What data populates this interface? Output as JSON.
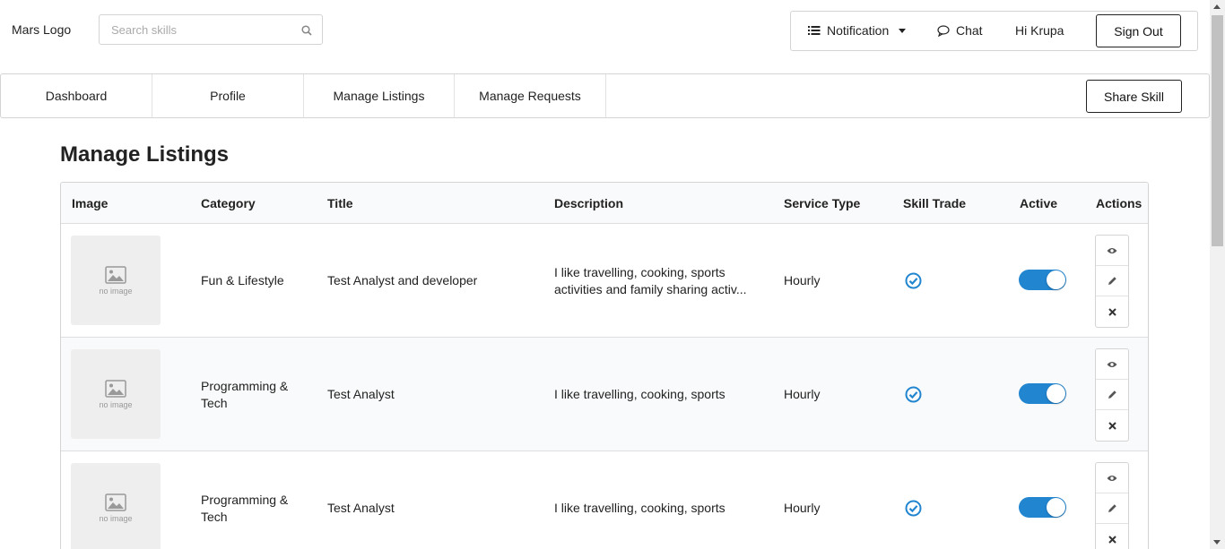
{
  "header": {
    "logo": "Mars Logo",
    "search_placeholder": "Search skills",
    "notification_label": "Notification",
    "chat_label": "Chat",
    "greeting": "Hi Krupa",
    "signout_label": "Sign Out"
  },
  "nav": {
    "tabs": [
      {
        "label": "Dashboard"
      },
      {
        "label": "Profile"
      },
      {
        "label": "Manage Listings"
      },
      {
        "label": "Manage Requests"
      }
    ],
    "share_label": "Share Skill"
  },
  "page_title": "Manage Listings",
  "table": {
    "columns": [
      "Image",
      "Category",
      "Title",
      "Description",
      "Service Type",
      "Skill Trade",
      "Active",
      "Actions"
    ],
    "no_image_text": "no image",
    "rows": [
      {
        "category": "Fun & Lifestyle",
        "title": "Test Analyst and developer",
        "description": "I like travelling, cooking, sports activities and family sharing activ...",
        "service_type": "Hourly",
        "skill_trade": true,
        "active": true
      },
      {
        "category": "Programming & Tech",
        "title": "Test Analyst",
        "description": "I like travelling, cooking, sports",
        "service_type": "Hourly",
        "skill_trade": true,
        "active": true
      },
      {
        "category": "Programming & Tech",
        "title": "Test Analyst",
        "description": "I like travelling, cooking, sports",
        "service_type": "Hourly",
        "skill_trade": true,
        "active": true
      }
    ]
  },
  "colors": {
    "accent": "#2185d0",
    "header_bg": "#f9fafb",
    "border": "#d4d4d5"
  },
  "icons": {
    "search": "search-icon",
    "notification": "list-icon",
    "dropdown": "caret-down-icon",
    "chat": "chat-bubble-icon",
    "image_placeholder": "image-icon",
    "skill_trade": "check-circle-icon",
    "view": "eye-icon",
    "edit": "pencil-icon",
    "delete": "close-icon"
  }
}
